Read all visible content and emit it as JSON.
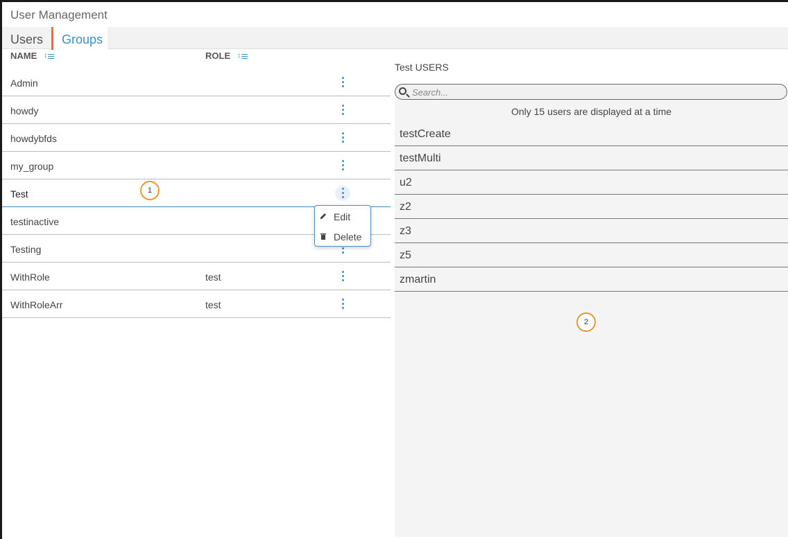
{
  "app": {
    "title": "User Management"
  },
  "tabs": [
    {
      "label": "Users",
      "active": false
    },
    {
      "label": "Groups",
      "active": true
    }
  ],
  "table": {
    "columns": {
      "name": "NAME",
      "role": "ROLE"
    },
    "rows": [
      {
        "name": "Admin",
        "role": ""
      },
      {
        "name": "howdy",
        "role": ""
      },
      {
        "name": "howdybfds",
        "role": ""
      },
      {
        "name": "my_group",
        "role": ""
      },
      {
        "name": "Test",
        "role": "",
        "selected": true
      },
      {
        "name": "testinactive",
        "role": ""
      },
      {
        "name": "Testing",
        "role": ""
      },
      {
        "name": "WithRole",
        "role": "test"
      },
      {
        "name": "WithRoleArr",
        "role": "test"
      }
    ]
  },
  "context_menu": {
    "edit_label": "Edit",
    "delete_label": "Delete"
  },
  "markers": {
    "one": "1",
    "two": "2"
  },
  "users_panel": {
    "title": "Test USERS",
    "search_placeholder": "Search...",
    "notice": "Only 15 users are displayed at a time",
    "users": [
      "testCreate",
      "testMulti",
      "u2",
      "z2",
      "z3",
      "z5",
      "zmartin"
    ]
  },
  "colors": {
    "accent": "#3a8fc7",
    "tab_indicator": "#e0703c",
    "marker": "#e8962e"
  }
}
